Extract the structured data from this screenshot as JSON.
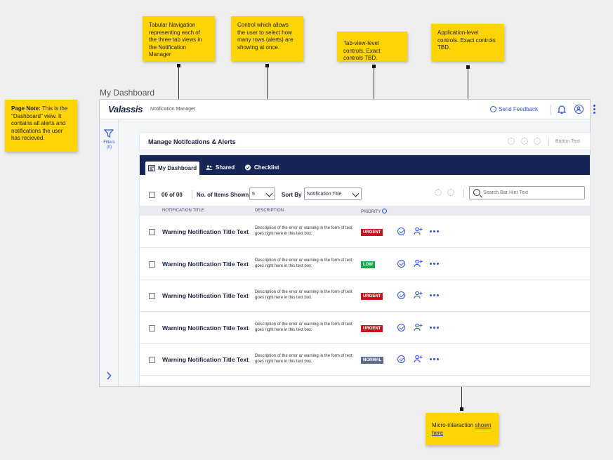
{
  "notes": {
    "page_note_label": "Page Note:",
    "page_note": " This is the \"Dashboard\" view. It contains all alerts and notifications the user has recieved.",
    "tab_nav": "Tabular Navigation representing each of the three tab views in the Notification Manager",
    "items_control": "Control which allows the user to select how many rows (alerts) are showing at once.",
    "tab_controls": "Tab-view-level controls. Exact controls TBD.",
    "app_controls": "Application-level controls. Exact controls TBD.",
    "micro_prefix": "Micro-interaction ",
    "micro_link": "shown here"
  },
  "page_label": "My Dashboard",
  "header": {
    "logo": "Valassis",
    "app_name": "Notification Manager",
    "feedback": "Send Feedback"
  },
  "sidebar": {
    "filters_label": "Filters",
    "filters_count": "(0)"
  },
  "card": {
    "title": "Manage Notifcations & Alerts",
    "button_text": "Button Text"
  },
  "tabs": [
    {
      "label": "My Dashboard"
    },
    {
      "label": "Shared"
    },
    {
      "label": "Checklist"
    }
  ],
  "toolbar": {
    "count": "00 of 00",
    "items_label": "No. of Items Shown",
    "items_value": "5",
    "sort_label": "Sort By",
    "sort_value": "Notification Title",
    "search_placeholder": "Search Bar Hint Text"
  },
  "columns": {
    "title": "NOTIFICATION TITLE",
    "description": "DESCRIPTION",
    "priority": "PRIORITY"
  },
  "rows": [
    {
      "title": "Warning Notification Title Text",
      "desc": "Description of the error or warning in the form of text goes right here in this text box.",
      "priority": "URGENT"
    },
    {
      "title": "Warning Notification Title Text",
      "desc": "Description of the error or warning in the form of text goes right here in this text box.",
      "priority": "LOW"
    },
    {
      "title": "Warning Notification Title Text",
      "desc": "Description of the error or warning in the form of text goes right here in this text box.",
      "priority": "URGENT"
    },
    {
      "title": "Warning Notification Title Text",
      "desc": "Description of the error or warning in the form of text goes right here in this text box.",
      "priority": "URGENT"
    },
    {
      "title": "Warning Notification Title Text",
      "desc": "Description of the error or warning in the form of text goes right here in this text box.",
      "priority": "NORMAL"
    }
  ],
  "colors": {
    "navy": "#172457",
    "accent": "#2f53d9",
    "urgent": "#c4161c",
    "low": "#18a84a",
    "normal": "#5b6b8c",
    "sticky": "#ffd400"
  }
}
